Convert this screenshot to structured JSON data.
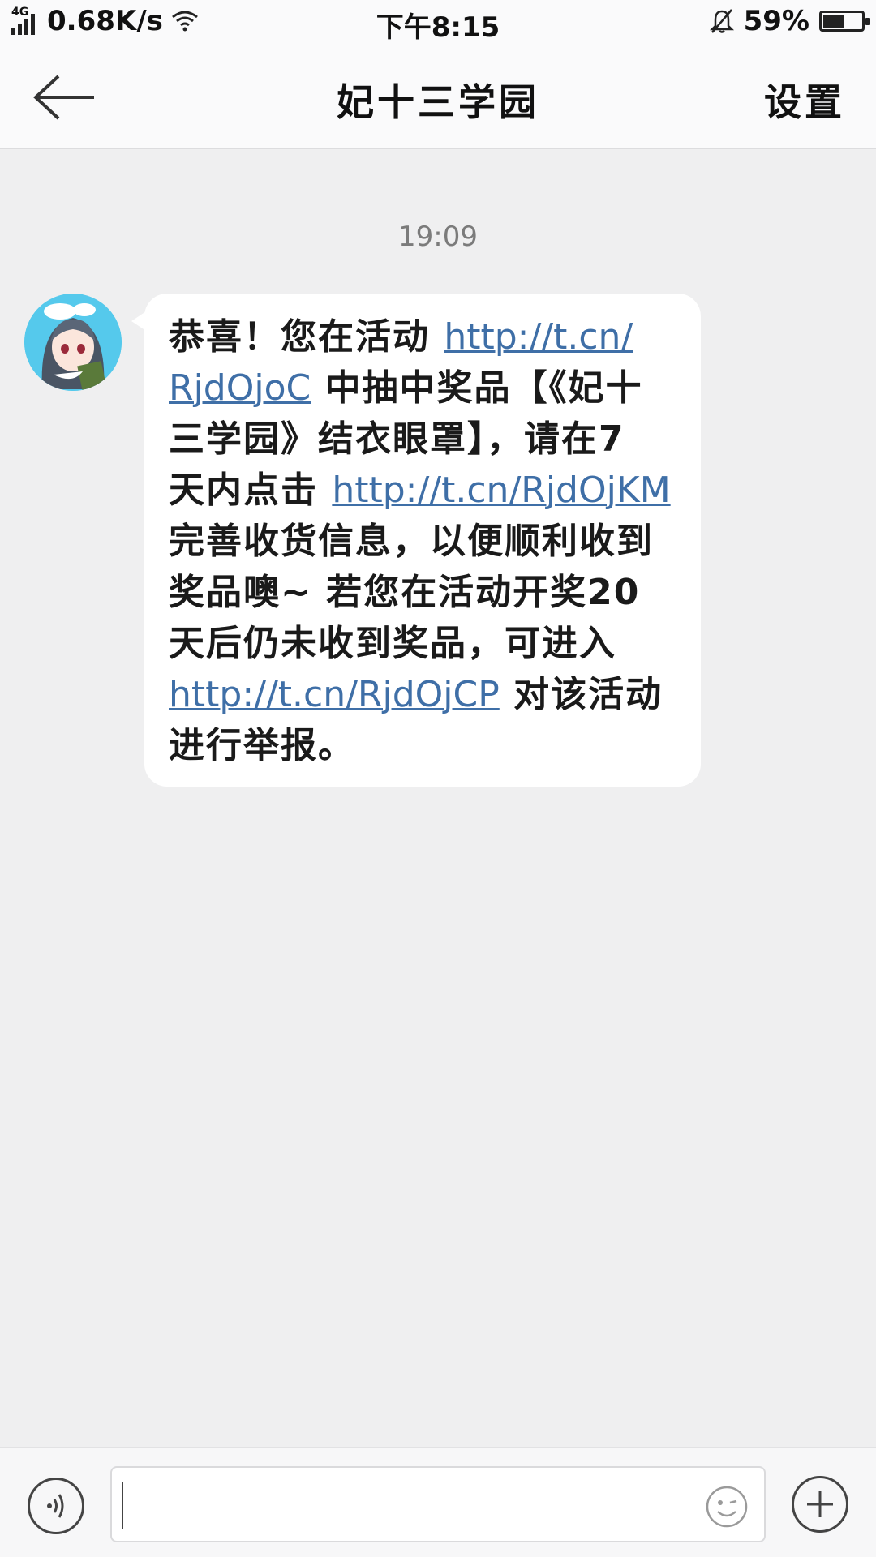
{
  "status_bar": {
    "network_type": "4G",
    "speed": "0.68K/s",
    "time": "下午8:15",
    "battery": "59%",
    "battery_level": 0.59
  },
  "nav": {
    "title": "妃十三学园",
    "settings_label": "设置"
  },
  "chat": {
    "timestamp": "19:09",
    "message": {
      "lines": [
        {
          "t1": "恭喜！您在活动 ",
          "link": "http://t.cn/",
          "t2": ""
        },
        {
          "t1": "",
          "link": "RjdOjoC",
          "t2": " 中抽中奖品【《妃十"
        },
        {
          "t1": "三学园》结衣眼罩】，请在7",
          "link": "",
          "t2": ""
        },
        {
          "t1": "天内点击 ",
          "link": "http://t.cn/RjdOjKM",
          "t2": ""
        },
        {
          "t1": "完善收货信息，以便顺利收到",
          "link": "",
          "t2": ""
        },
        {
          "t1": "奖品噢~ 若您在活动开奖20",
          "link": "",
          "t2": ""
        },
        {
          "t1": "天后仍未收到奖品，可进入",
          "link": "",
          "t2": ""
        },
        {
          "t1": "",
          "link": "http://t.cn/RjdOjCP",
          "t2": " 对该活动"
        },
        {
          "t1": "进行举报。",
          "link": "",
          "t2": ""
        }
      ]
    }
  },
  "icons": {
    "back": "back-arrow-icon",
    "voice": "voice-icon",
    "emoji": "emoji-icon",
    "add": "plus-icon",
    "mute": "bell-off-icon",
    "wifi": "wifi-icon",
    "signal": "signal-icon",
    "battery": "battery-icon"
  },
  "colors": {
    "link": "#3f6fa7",
    "background": "#efeff0",
    "bubble": "#ffffff"
  }
}
